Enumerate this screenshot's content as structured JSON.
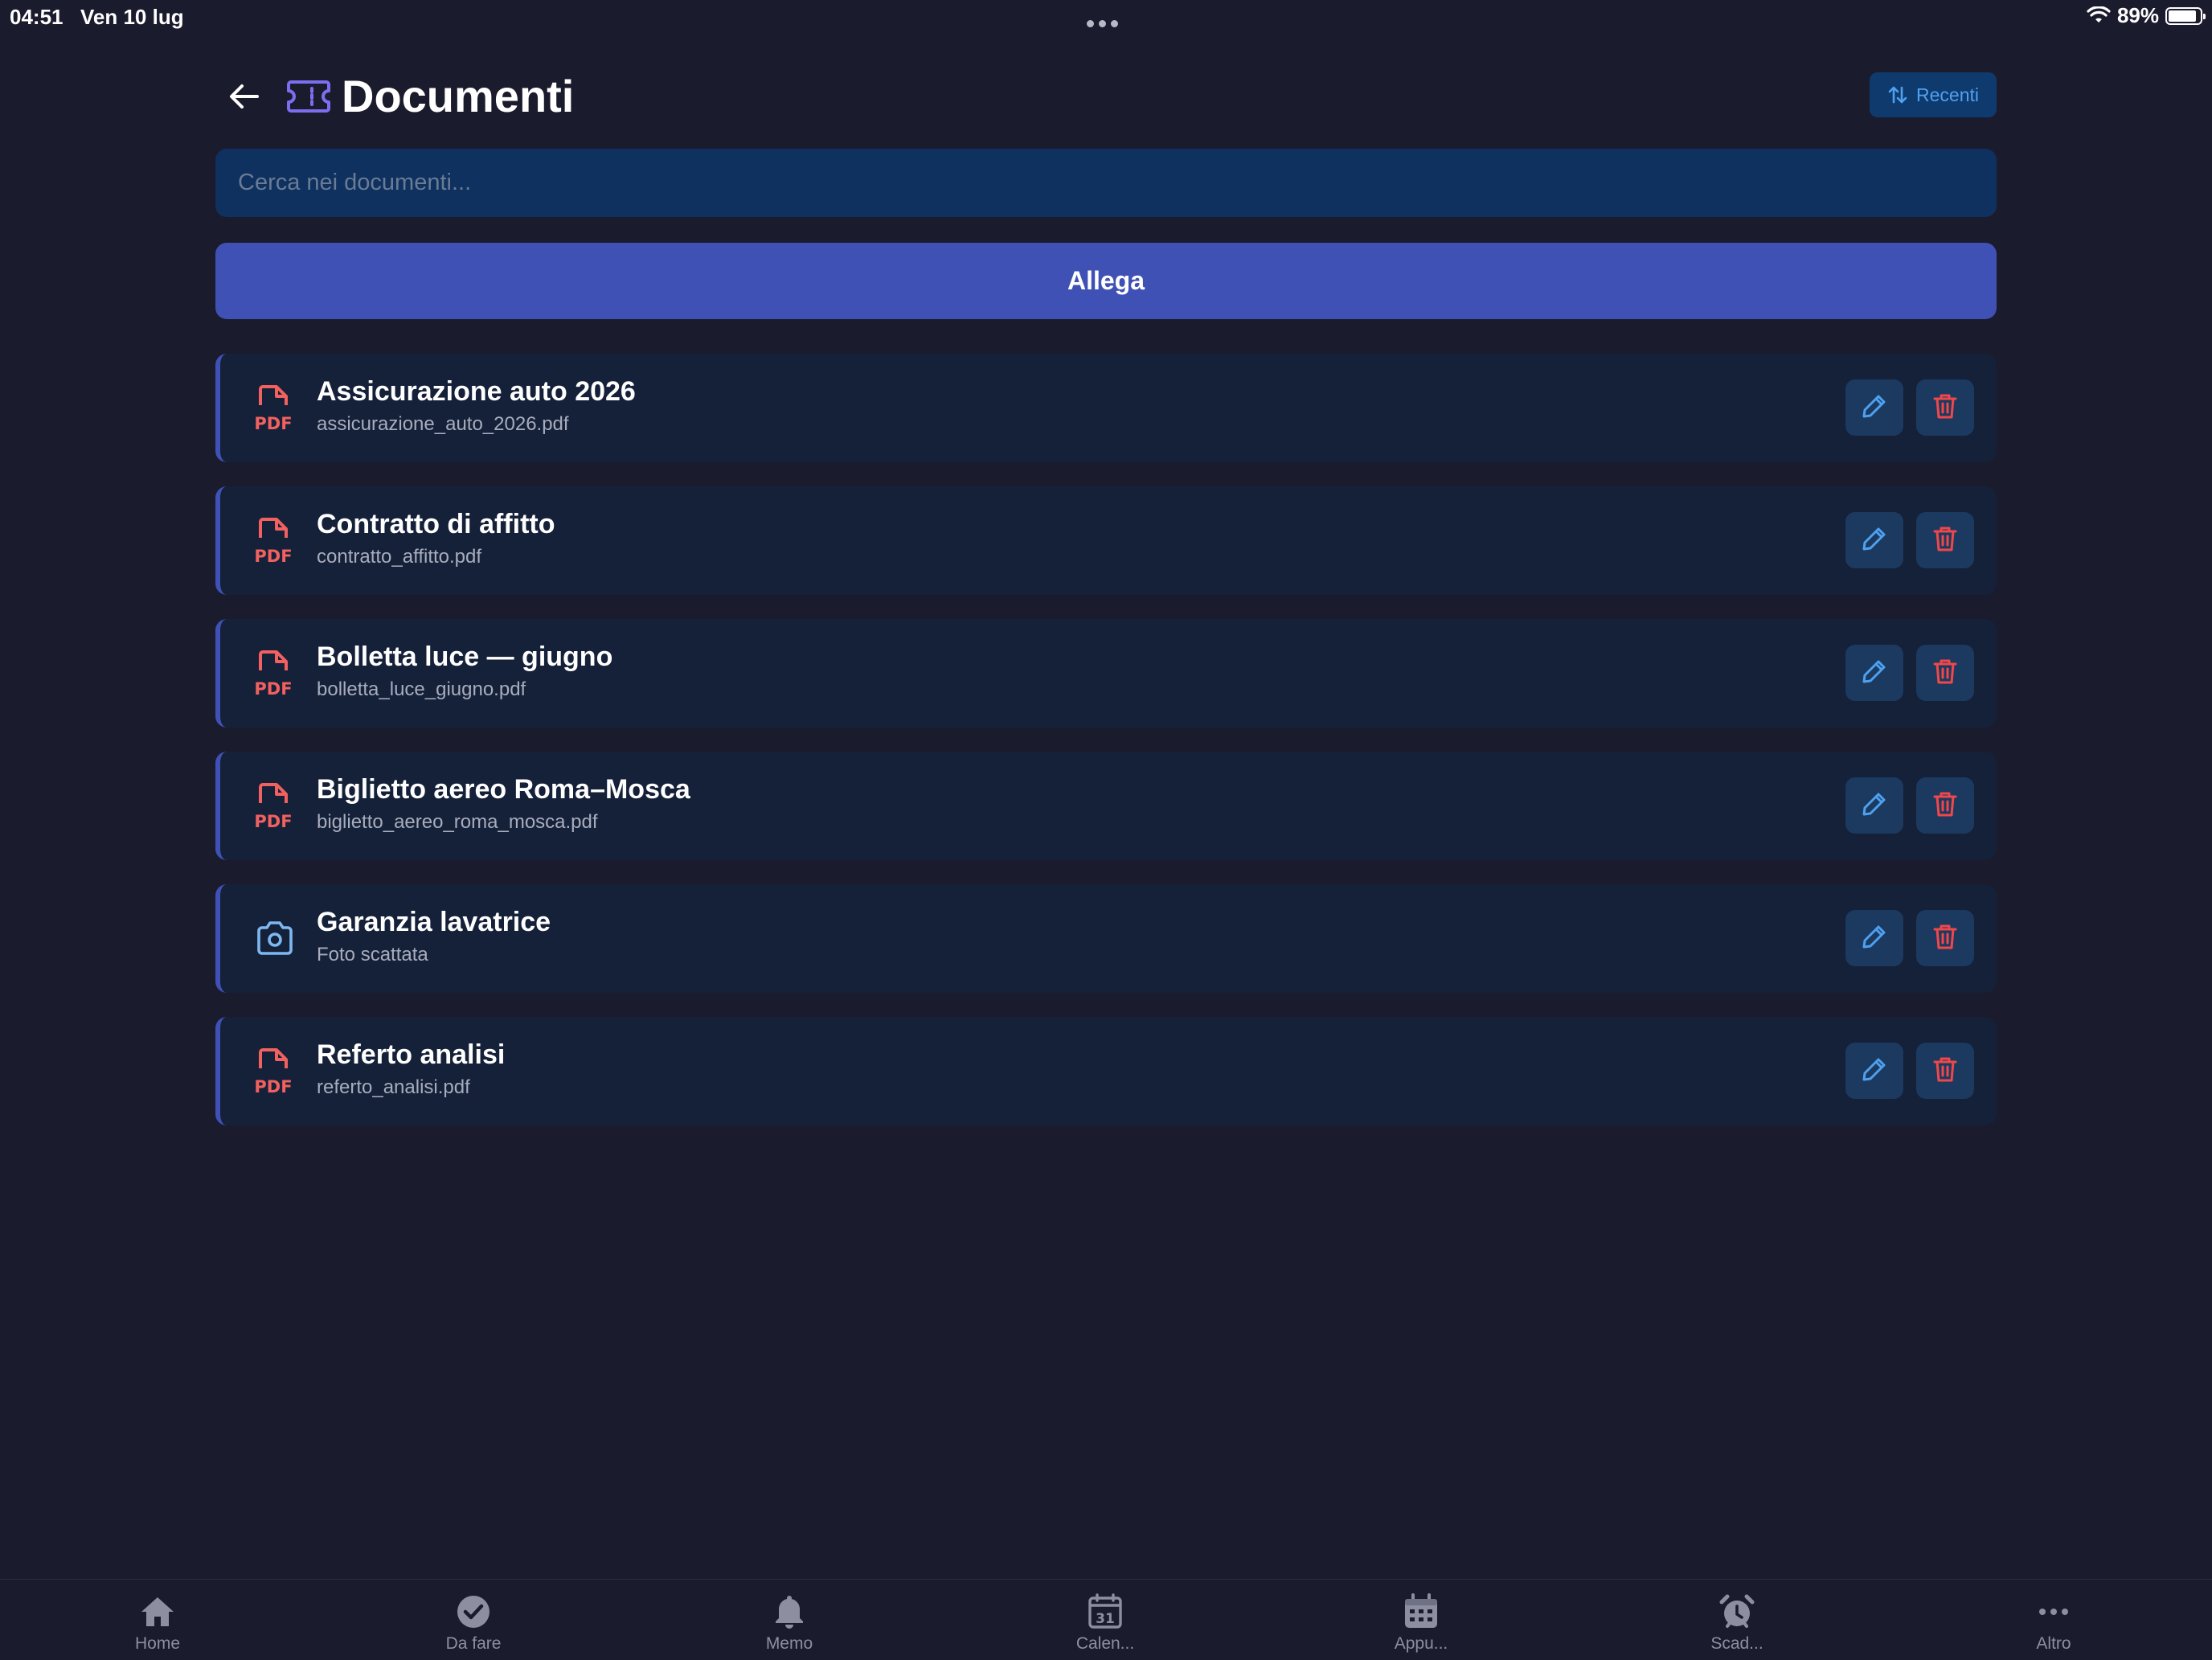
{
  "status_bar": {
    "time": "04:51",
    "date": "Ven 10 lug",
    "battery": "89%"
  },
  "header": {
    "title": "Documenti",
    "sort_label": "Recenti"
  },
  "search": {
    "placeholder": "Cerca nei documenti..."
  },
  "attach_label": "Allega",
  "documents": [
    {
      "name": "Assicurazione auto 2026",
      "file": "assicurazione_auto_2026.pdf",
      "icon": "pdf-icon"
    },
    {
      "name": "Contratto di affitto",
      "file": "contratto_affitto.pdf",
      "icon": "pdf-icon"
    },
    {
      "name": "Bolletta luce — giugno",
      "file": "bolletta_luce_giugno.pdf",
      "icon": "pdf-icon"
    },
    {
      "name": "Biglietto aereo Roma–Mosca",
      "file": "biglietto_aereo_roma_mosca.pdf",
      "icon": "pdf-icon"
    },
    {
      "name": "Garanzia lavatrice",
      "file": "Foto scattata",
      "icon": "camera-icon"
    },
    {
      "name": "Referto analisi",
      "file": "referto_analisi.pdf",
      "icon": "pdf-icon"
    }
  ],
  "tabs": [
    {
      "label": "Home",
      "icon": "home-icon"
    },
    {
      "label": "Da fare",
      "icon": "check-circle-icon"
    },
    {
      "label": "Memo",
      "icon": "bell-icon"
    },
    {
      "label": "Calen...",
      "icon": "calendar-31-icon",
      "icon_text": "31"
    },
    {
      "label": "Appu...",
      "icon": "calendar-grid-icon"
    },
    {
      "label": "Scad...",
      "icon": "alarm-clock-icon"
    },
    {
      "label": "Altro",
      "icon": "more-icon"
    }
  ],
  "colors": {
    "background": "#1b1b2e",
    "accent": "#3f51b5",
    "card": "#152039",
    "search_bg": "#0e315f",
    "pdf_red": "#f0615f",
    "edit_blue": "#4ea1f0",
    "delete_red": "#f0474a",
    "title_icon_purple": "#7b6ff0"
  }
}
